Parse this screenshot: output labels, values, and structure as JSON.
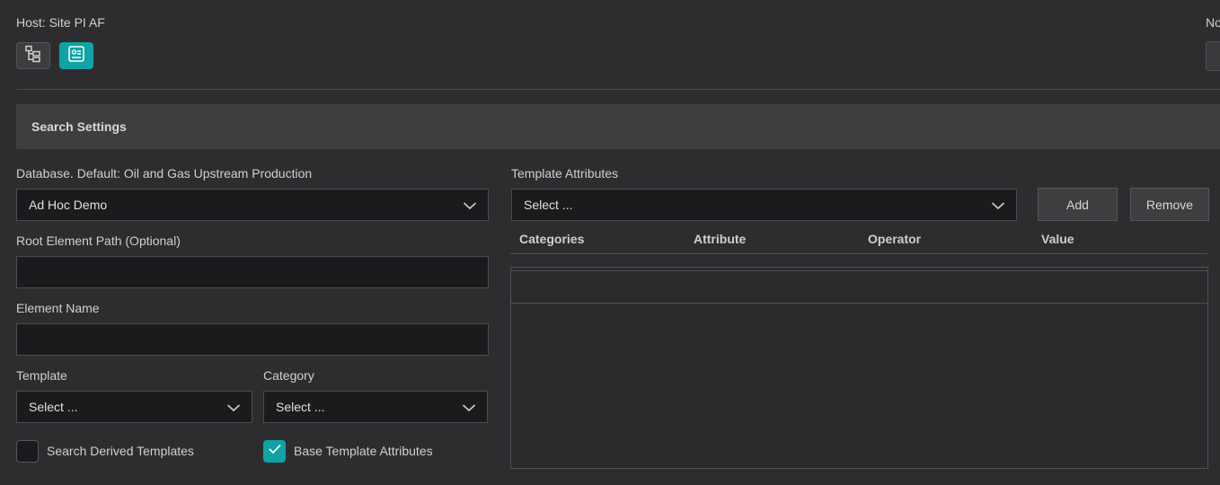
{
  "header": {
    "host_label": "Host: Site PI AF",
    "right_label_partial": "No"
  },
  "view_buttons": {
    "tree_icon": "tree-view-icon",
    "card_icon": "card-view-icon",
    "active": "card",
    "accent_color": "#0fa3a3"
  },
  "search_settings": {
    "title": "Search Settings",
    "database": {
      "label": "Database. Default: Oil and Gas Upstream Production",
      "value": "Ad Hoc Demo"
    },
    "root_element_path": {
      "label": "Root Element Path (Optional)",
      "value": ""
    },
    "element_name": {
      "label": "Element Name",
      "value": ""
    },
    "template": {
      "label": "Template",
      "value": "Select ..."
    },
    "category": {
      "label": "Category",
      "value": "Select ..."
    },
    "search_derived_templates": {
      "label": "Search Derived Templates",
      "checked": false
    },
    "base_template_attributes": {
      "label": "Base Template Attributes",
      "checked": true
    }
  },
  "template_attributes": {
    "label": "Template Attributes",
    "select_value": "Select ...",
    "add_label": "Add",
    "remove_label": "Remove",
    "columns": [
      "Categories",
      "Attribute",
      "Operator",
      "Value"
    ]
  }
}
